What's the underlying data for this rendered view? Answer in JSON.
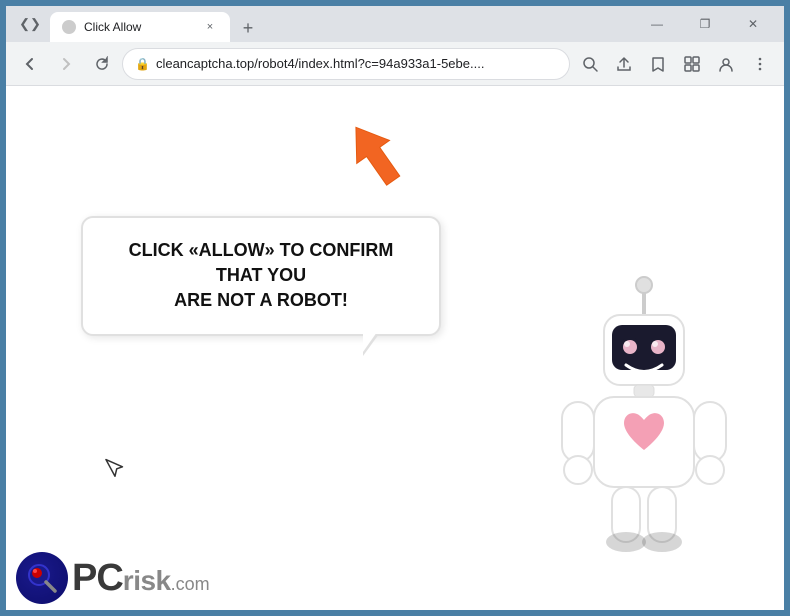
{
  "window": {
    "title": "Click Allow",
    "borderColor": "#4a7fa5"
  },
  "titlebar": {
    "tab_title": "Click Allow",
    "new_tab_label": "+",
    "close_label": "×",
    "minimize_label": "—",
    "maximize_label": "❐",
    "chevron_label": "❮"
  },
  "toolbar": {
    "back_label": "←",
    "forward_label": "→",
    "reload_label": "×",
    "url": "cleancaptcha.top/robot4/index.html?c=94a933a1-5ebe....",
    "search_icon_label": "🔍",
    "share_icon_label": "↗",
    "bookmark_icon_label": "☆",
    "extension_icon_label": "⬜",
    "profile_icon_label": "👤",
    "menu_icon_label": "⋮"
  },
  "page": {
    "bubble_text_line1": "CLICK «ALLOW» TO CONFIRM THAT YOU",
    "bubble_text_line2": "ARE NOT A ROBOT!",
    "bubble_full": "CLICK «ALLOW» TO CONFIRM THAT YOU ARE NOT A ROBOT!"
  },
  "watermark": {
    "pc_text": "PC",
    "risk_text": "risk",
    "com_text": ".com"
  }
}
